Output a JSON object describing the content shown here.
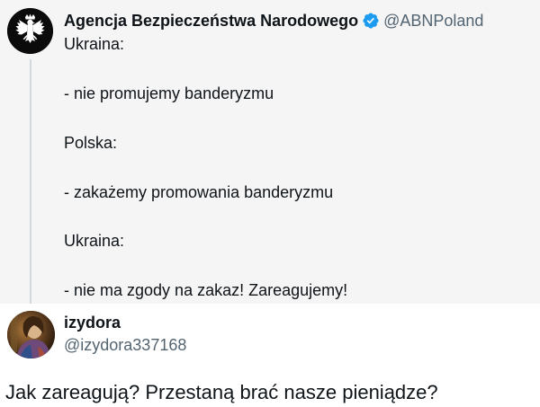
{
  "tweet": {
    "author_name": "Agencja Bezpieczeństwa Narodowego",
    "author_handle": "@ABNPoland",
    "verified": true,
    "body_lines": [
      "Ukraina:",
      "- nie promujemy banderyzmu",
      "Polska:",
      "- zakażemy promowania banderyzmu",
      "Ukraina:",
      "- nie ma zgody na zakaz! Zareagujemy!"
    ]
  },
  "reply": {
    "author_name": "izydora",
    "author_handle": "@izydora337168",
    "text": "Jak zareagują? Przestaną brać nasze pieniądze?"
  },
  "colors": {
    "verified_badge": "#1d9bf0",
    "muted_text": "#536471",
    "thread_line": "#cfd9de",
    "top_background": "#f5f5f5"
  },
  "icons": {
    "top_avatar": "white-eagle-emblem-icon",
    "verified": "verified-badge-icon",
    "reply_avatar": "user-photo-avatar"
  }
}
